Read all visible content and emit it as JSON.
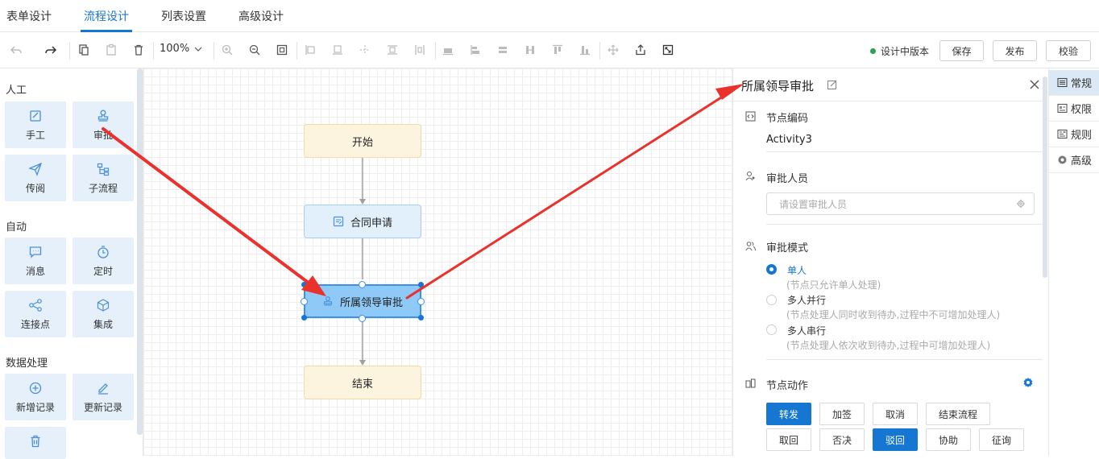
{
  "tabs": [
    "表单设计",
    "流程设计",
    "列表设置",
    "高级设计"
  ],
  "toolbar": {
    "zoom": "100%",
    "version_label": "设计中版本",
    "save": "保存",
    "publish": "发布",
    "validate": "校验"
  },
  "palette": {
    "groups": [
      {
        "title": "人工",
        "items": [
          "手工",
          "审批",
          "传阅",
          "子流程"
        ]
      },
      {
        "title": "自动",
        "items": [
          "消息",
          "定时",
          "连接点",
          "集成"
        ]
      },
      {
        "title": "数据处理",
        "items": [
          "新增记录",
          "更新记录"
        ]
      }
    ]
  },
  "flow": {
    "nodes": [
      "开始",
      "合同申请",
      "所属领导审批",
      "结束"
    ]
  },
  "panel": {
    "title": "所属领导审批",
    "node_code_label": "节点编码",
    "node_code_value": "Activity3",
    "approver_label": "审批人员",
    "approver_placeholder": "请设置审批人员",
    "mode_label": "审批模式",
    "modes": [
      {
        "label": "单人",
        "hint": "(节点只允许单人处理)",
        "selected": true
      },
      {
        "label": "多人并行",
        "hint": "(节点处理人同时收到待办,过程中不可增加处理人)",
        "selected": false
      },
      {
        "label": "多人串行",
        "hint": "(节点处理人依次收到待办,过程中可增加处理人)",
        "selected": false
      }
    ],
    "actions_label": "节点动作",
    "actions_row1": [
      {
        "label": "转发",
        "primary": true
      },
      {
        "label": "加签",
        "primary": false
      },
      {
        "label": "取消",
        "primary": false
      },
      {
        "label": "结束流程",
        "primary": false
      }
    ],
    "actions_row2": [
      {
        "label": "取回",
        "primary": false
      },
      {
        "label": "否决",
        "primary": false
      },
      {
        "label": "驳回",
        "primary": true
      },
      {
        "label": "协助",
        "primary": false
      },
      {
        "label": "征询",
        "primary": false
      }
    ]
  },
  "side_tabs": [
    "常规",
    "权限",
    "规则",
    "高级"
  ],
  "colors": {
    "accent": "#1677d2",
    "annotation": "#e8322b",
    "status": "#2aa14b"
  }
}
